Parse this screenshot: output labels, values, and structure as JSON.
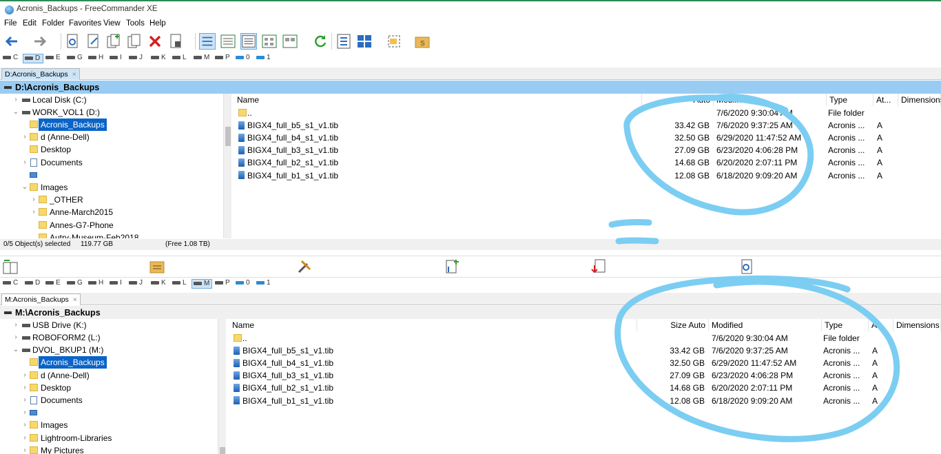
{
  "window": {
    "title": "Acronis_Backups - FreeCommander XE"
  },
  "menu": [
    "File",
    "Edit",
    "Folder",
    "Favorites",
    "View",
    "Tools",
    "Help"
  ],
  "toolbar": {
    "icons": [
      "back-arrow-icon",
      "forward-arrow-icon",
      "find-file-icon",
      "edit-file-icon",
      "copy-file-icon",
      "move-file-icon",
      "delete-icon",
      "properties-icon",
      "view-brief-icon",
      "view-details-icon",
      "view-list-icon",
      "view-thumbnails-icon",
      "view-large-icon",
      "refresh-icon",
      "checklist-icon",
      "layout-icon",
      "select-icon",
      "folder-s-icon"
    ]
  },
  "drives": [
    "C",
    "D",
    "E",
    "G",
    "H",
    "I",
    "J",
    "K",
    "L",
    "M",
    "P",
    "0",
    "1"
  ],
  "top_panel": {
    "tab": "D:Acronis_Backups",
    "tab_close": "×",
    "path": "D:\\Acronis_Backups",
    "selected_drive": "D",
    "tree": [
      {
        "label": "Local Disk (C:)",
        "icon": "drive-icon",
        "chevron": "›"
      },
      {
        "label": "WORK_VOL1 (D:)",
        "icon": "drive-icon",
        "chevron": "⌄"
      },
      {
        "label": "Acronis_Backups",
        "icon": "folder-icon",
        "chevron": ""
      },
      {
        "label": "d (Anne-Dell)",
        "icon": "folder-icon",
        "chevron": "›"
      },
      {
        "label": "Desktop",
        "icon": "folder-icon",
        "chevron": ""
      },
      {
        "label": "Documents",
        "icon": "documents-icon",
        "chevron": "›"
      },
      {
        "label": "",
        "icon": "image-icon",
        "chevron": ""
      },
      {
        "label": "Images",
        "icon": "folder-icon",
        "chevron": "⌄"
      },
      {
        "label": "_OTHER",
        "icon": "folder-icon",
        "chevron": "›"
      },
      {
        "label": "Anne-March2015",
        "icon": "folder-icon",
        "chevron": "›"
      },
      {
        "label": "Annes-G7-Phone",
        "icon": "folder-icon",
        "chevron": ""
      },
      {
        "label": "Autry-Museum-Feb2018",
        "icon": "folder-icon",
        "chevron": ""
      }
    ],
    "columns": {
      "name": "Name",
      "size": "Auto",
      "modified": "Modified",
      "type": "Type",
      "attr": "At...",
      "dimensions": "Dimensions"
    },
    "files": [
      {
        "name": "..",
        "size": "",
        "modified": "7/6/2020 9:30:04 AM",
        "type": "File folder",
        "attr": ""
      },
      {
        "name": "BIGX4_full_b5_s1_v1.tib",
        "size": "33.42 GB",
        "modified": "7/6/2020 9:37:25 AM",
        "type": "Acronis ...",
        "attr": "A"
      },
      {
        "name": "BIGX4_full_b4_s1_v1.tib",
        "size": "32.50 GB",
        "modified": "6/29/2020 11:47:52 AM",
        "type": "Acronis ...",
        "attr": "A"
      },
      {
        "name": "BIGX4_full_b3_s1_v1.tib",
        "size": "27.09 GB",
        "modified": "6/23/2020 4:06:28 PM",
        "type": "Acronis ...",
        "attr": "A"
      },
      {
        "name": "BIGX4_full_b2_s1_v1.tib",
        "size": "14.68 GB",
        "modified": "6/20/2020 2:07:11 PM",
        "type": "Acronis ...",
        "attr": "A"
      },
      {
        "name": "BIGX4_full_b1_s1_v1.tib",
        "size": "12.08 GB",
        "modified": "6/18/2020 9:09:20 AM",
        "type": "Acronis ...",
        "attr": "A"
      }
    ],
    "status": {
      "selected": "0/5 Object(s) selected",
      "size": "119.77 GB",
      "free": "(Free 1.08 TB)"
    }
  },
  "function_bar": {
    "icons": [
      "compare-panels-icon",
      "folder-tree-icon",
      "tools-icon",
      "copy-to-icon",
      "move-to-icon",
      "view-file-icon"
    ]
  },
  "bottom_panel": {
    "tab": "M:Acronis_Backups",
    "tab_close": "×",
    "path": "M:\\Acronis_Backups",
    "selected_drive": "M",
    "tree": [
      {
        "label": "USB Drive (K:)",
        "icon": "drive-icon",
        "chevron": "›"
      },
      {
        "label": "ROBOFORM2 (L:)",
        "icon": "drive-icon",
        "chevron": "›"
      },
      {
        "label": "DVOL_BKUP1 (M:)",
        "icon": "drive-icon",
        "chevron": "⌄"
      },
      {
        "label": "Acronis_Backups",
        "icon": "folder-icon",
        "chevron": ""
      },
      {
        "label": "d (Anne-Dell)",
        "icon": "folder-icon",
        "chevron": "›"
      },
      {
        "label": "Desktop",
        "icon": "folder-icon",
        "chevron": "›"
      },
      {
        "label": "Documents",
        "icon": "documents-icon",
        "chevron": "›"
      },
      {
        "label": "",
        "icon": "image-icon",
        "chevron": "›"
      },
      {
        "label": "Images",
        "icon": "folder-icon",
        "chevron": "›"
      },
      {
        "label": "Lightroom-Libraries",
        "icon": "folder-icon",
        "chevron": "›"
      },
      {
        "label": "My Pictures",
        "icon": "folder-icon",
        "chevron": "›"
      }
    ],
    "columns": {
      "name": "Name",
      "size": "Size Auto",
      "modified": "Modified",
      "type": "Type",
      "attr": "A...",
      "dimensions": "Dimensions"
    },
    "files": [
      {
        "name": "..",
        "size": "",
        "modified": "7/6/2020 9:30:04 AM",
        "type": "File folder",
        "attr": ""
      },
      {
        "name": "BIGX4_full_b5_s1_v1.tib",
        "size": "33.42 GB",
        "modified": "7/6/2020 9:37:25 AM",
        "type": "Acronis ...",
        "attr": "A"
      },
      {
        "name": "BIGX4_full_b4_s1_v1.tib",
        "size": "32.50 GB",
        "modified": "6/29/2020 11:47:52 AM",
        "type": "Acronis ...",
        "attr": "A"
      },
      {
        "name": "BIGX4_full_b3_s1_v1.tib",
        "size": "27.09 GB",
        "modified": "6/23/2020 4:06:28 PM",
        "type": "Acronis ...",
        "attr": "A"
      },
      {
        "name": "BIGX4_full_b2_s1_v1.tib",
        "size": "14.68 GB",
        "modified": "6/20/2020 2:07:11 PM",
        "type": "Acronis ...",
        "attr": "A"
      },
      {
        "name": "BIGX4_full_b1_s1_v1.tib",
        "size": "12.08 GB",
        "modified": "6/18/2020 9:09:20 AM",
        "type": "Acronis ...",
        "attr": "A"
      }
    ]
  },
  "annotation": {
    "color": "#7ccdf2"
  }
}
